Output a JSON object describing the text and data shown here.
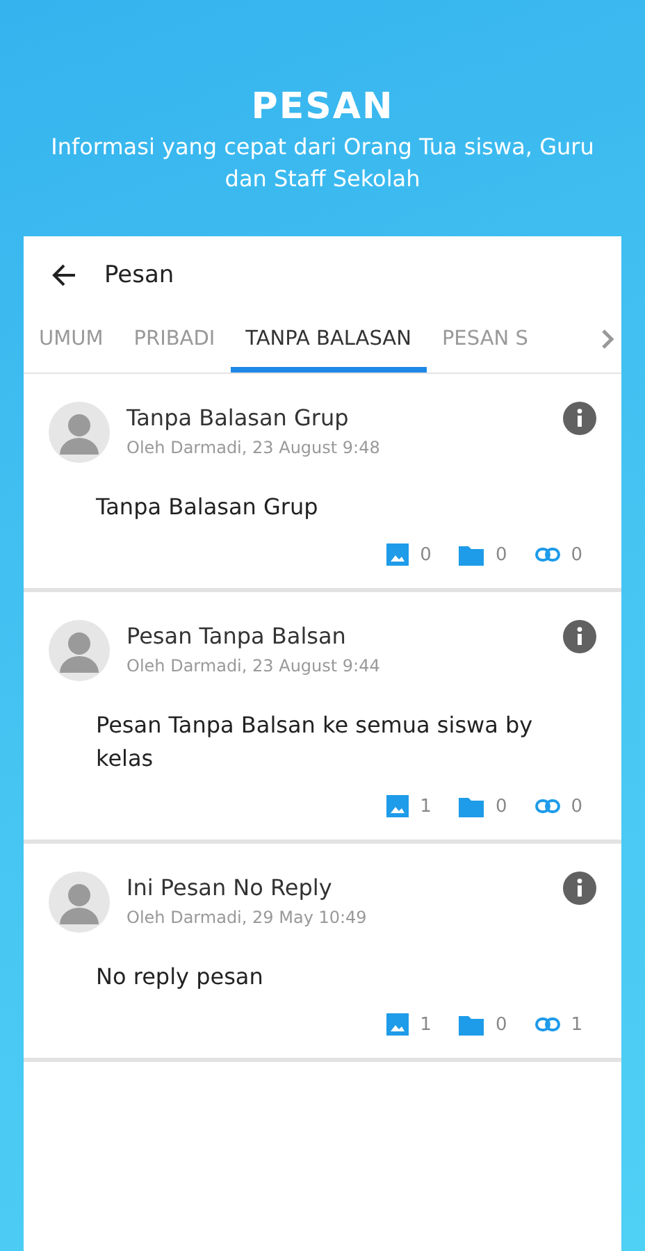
{
  "header": {
    "title": "PESAN",
    "subtitle": "Informasi yang cepat dari Orang Tua siswa, Guru dan Staff Sekolah"
  },
  "card": {
    "title": "Pesan"
  },
  "tabs": [
    {
      "label": "UMUM",
      "selected": false
    },
    {
      "label": "PRIBADI",
      "selected": false
    },
    {
      "label": "TANPA BALASAN",
      "selected": true
    },
    {
      "label": "PESAN S",
      "selected": false
    }
  ],
  "messages": [
    {
      "title": "Tanpa Balasan Grup",
      "meta": "Oleh Darmadi, 23 August 9:48",
      "body": "Tanpa Balasan Grup",
      "images": "0",
      "files": "0",
      "links": "0"
    },
    {
      "title": "Pesan Tanpa Balsan",
      "meta": "Oleh Darmadi, 23 August 9:44",
      "body": "Pesan Tanpa Balsan ke semua siswa by kelas",
      "images": "1",
      "files": "0",
      "links": "0"
    },
    {
      "title": "Ini Pesan No Reply",
      "meta": "Oleh Darmadi, 29 May 10:49",
      "body": "No reply pesan",
      "images": "1",
      "files": "0",
      "links": "1"
    }
  ]
}
